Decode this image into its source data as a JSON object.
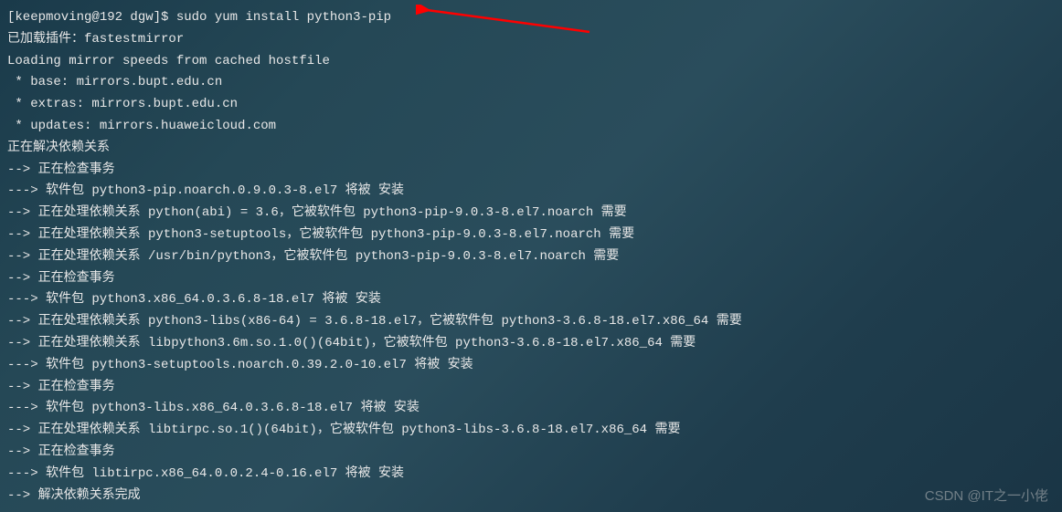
{
  "terminal": {
    "prompt": "[keepmoving@192 dgw]$ ",
    "command": "sudo yum install python3-pip",
    "lines": [
      "已加载插件：fastestmirror",
      "Loading mirror speeds from cached hostfile",
      " * base: mirrors.bupt.edu.cn",
      " * extras: mirrors.bupt.edu.cn",
      " * updates: mirrors.huaweicloud.com",
      "正在解决依赖关系",
      "--> 正在检查事务",
      "---> 软件包 python3-pip.noarch.0.9.0.3-8.el7 将被 安装",
      "--> 正在处理依赖关系 python(abi) = 3.6，它被软件包 python3-pip-9.0.3-8.el7.noarch 需要",
      "--> 正在处理依赖关系 python3-setuptools，它被软件包 python3-pip-9.0.3-8.el7.noarch 需要",
      "--> 正在处理依赖关系 /usr/bin/python3，它被软件包 python3-pip-9.0.3-8.el7.noarch 需要",
      "--> 正在检查事务",
      "---> 软件包 python3.x86_64.0.3.6.8-18.el7 将被 安装",
      "--> 正在处理依赖关系 python3-libs(x86-64) = 3.6.8-18.el7，它被软件包 python3-3.6.8-18.el7.x86_64 需要",
      "--> 正在处理依赖关系 libpython3.6m.so.1.0()(64bit)，它被软件包 python3-3.6.8-18.el7.x86_64 需要",
      "---> 软件包 python3-setuptools.noarch.0.39.2.0-10.el7 将被 安装",
      "--> 正在检查事务",
      "---> 软件包 python3-libs.x86_64.0.3.6.8-18.el7 将被 安装",
      "--> 正在处理依赖关系 libtirpc.so.1()(64bit)，它被软件包 python3-libs-3.6.8-18.el7.x86_64 需要",
      "--> 正在检查事务",
      "---> 软件包 libtirpc.x86_64.0.0.2.4-0.16.el7 将被 安装",
      "--> 解决依赖关系完成"
    ]
  },
  "watermark": "CSDN @IT之一小佬",
  "annotation": {
    "arrow_color": "#ff0000"
  }
}
